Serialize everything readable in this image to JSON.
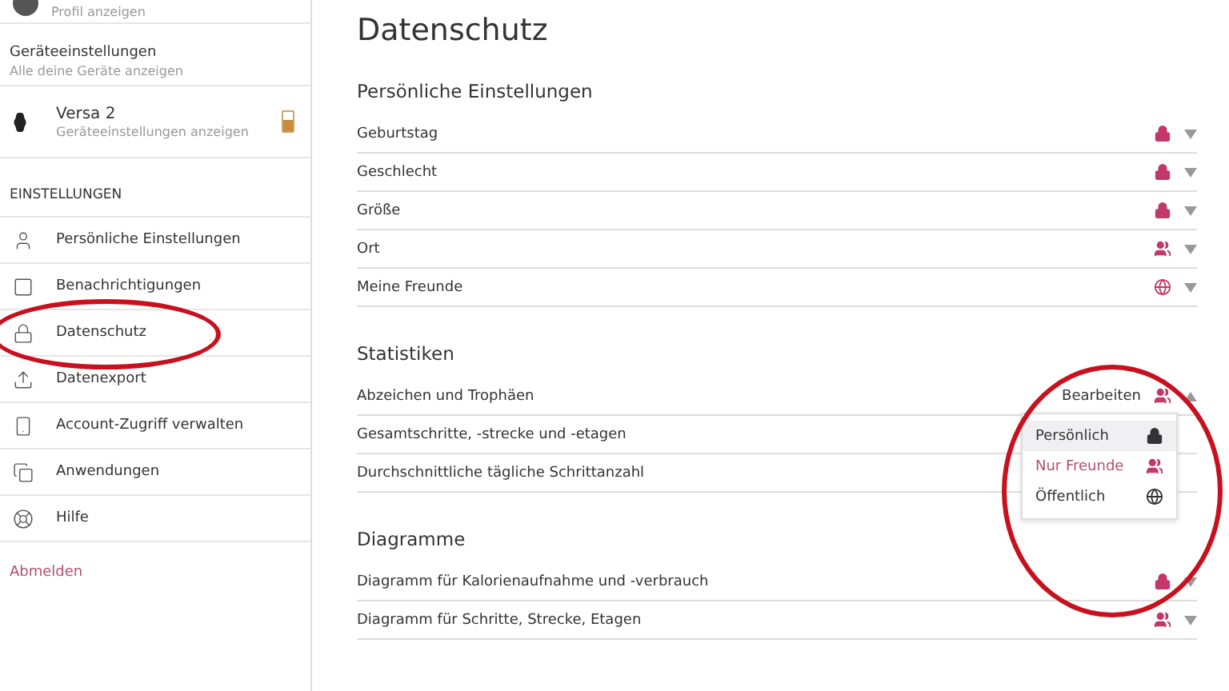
{
  "sidebar": {
    "profile": {
      "subtitle": "Profil anzeigen"
    },
    "devices_header": {
      "title": "Geräteeinstellungen",
      "subtitle": "Alle deine Geräte anzeigen"
    },
    "device": {
      "name": "Versa 2",
      "subtitle": "Geräteeinstellungen anzeigen"
    },
    "section_title": "EINSTELLUNGEN",
    "items": [
      {
        "label": "Persönliche Einstellungen",
        "kind": "person"
      },
      {
        "label": "Benachrichtigungen",
        "kind": "notification"
      },
      {
        "label": "Datenschutz",
        "kind": "lock"
      },
      {
        "label": "Datenexport",
        "kind": "export"
      },
      {
        "label": "Account-Zugriff verwalten",
        "kind": "phone"
      },
      {
        "label": "Anwendungen",
        "kind": "apps"
      },
      {
        "label": "Hilfe",
        "kind": "help"
      }
    ],
    "logout": "Abmelden"
  },
  "page_title": "Datenschutz",
  "sections": [
    {
      "title": "Persönliche Einstellungen",
      "rows": [
        {
          "label": "Geburtstag",
          "kind": "private",
          "expanded": false
        },
        {
          "label": "Geschlecht",
          "kind": "private",
          "expanded": false
        },
        {
          "label": "Größe",
          "kind": "private",
          "expanded": false
        },
        {
          "label": "Ort",
          "kind": "friends",
          "expanded": false
        },
        {
          "label": "Meine Freunde",
          "kind": "public",
          "expanded": false
        }
      ]
    },
    {
      "title": "Statistiken",
      "rows": [
        {
          "label": "Abzeichen und Trophäen",
          "kind": "friends",
          "expanded": true,
          "action": "Bearbeiten",
          "menu": [
            {
              "label": "Persönlich",
              "kind": "private",
              "selected": false,
              "highlighted": true
            },
            {
              "label": "Nur Freunde",
              "kind": "friends",
              "selected": true,
              "highlighted": false
            },
            {
              "label": "Öffentlich",
              "kind": "public",
              "selected": false,
              "highlighted": false
            }
          ]
        },
        {
          "label": "Gesamtschritte, -strecke und -etagen"
        },
        {
          "label": "Durchschnittliche tägliche Schrittanzahl"
        }
      ]
    },
    {
      "title": "Diagramme",
      "rows": [
        {
          "label": "Diagramm für Kalorienaufnahme und -verbrauch",
          "kind": "private",
          "expanded": false
        },
        {
          "label": "Diagramm für Schritte, Strecke, Etagen",
          "kind": "friends",
          "expanded": false
        }
      ]
    }
  ]
}
